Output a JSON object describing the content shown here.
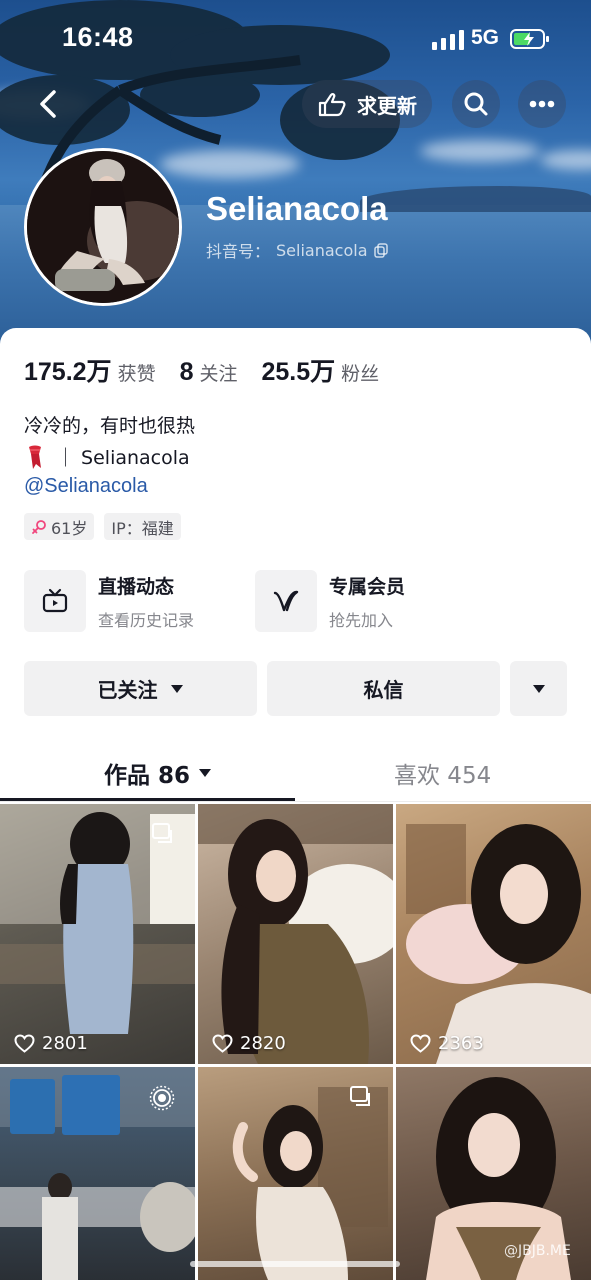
{
  "status": {
    "time": "16:48",
    "network": "5G"
  },
  "header": {
    "update_label": "求更新",
    "nickname": "Selianacola",
    "douyin_id_label": "抖音号：",
    "douyin_id": "Selianacola"
  },
  "stats": [
    {
      "value": "175.2万",
      "label": "获赞"
    },
    {
      "value": "8",
      "label": "关注"
    },
    {
      "value": "25.5万",
      "label": "粉丝"
    }
  ],
  "bio": {
    "line1": "冷冷的，有时也很热",
    "line2": "｜ Selianacola",
    "handle": "@Selianacola"
  },
  "tags": {
    "age": "61岁",
    "ip": "IP：福建"
  },
  "features": {
    "live": {
      "title": "直播动态",
      "subtitle": "查看历史记录"
    },
    "member": {
      "title": "专属会员",
      "subtitle": "抢先加入"
    }
  },
  "actions": {
    "follow": "已关注",
    "message": "私信"
  },
  "tabs": {
    "works": "作品 86",
    "likes": "喜欢 454"
  },
  "posts": [
    {
      "likes": "2801"
    },
    {
      "likes": "2820"
    },
    {
      "likes": "2363"
    },
    {
      "likes": ""
    },
    {
      "likes": ""
    },
    {
      "likes": ""
    }
  ],
  "watermark": "@JBJB.ME",
  "icons": [
    "back-icon",
    "hand-point-icon",
    "search-icon",
    "more-icon",
    "copy-icon",
    "tv-icon",
    "v-icon",
    "caret-down-icon",
    "heart-icon",
    "female-icon",
    "scarf-emoji-icon",
    "pin-icon",
    "live-photo-icon"
  ]
}
